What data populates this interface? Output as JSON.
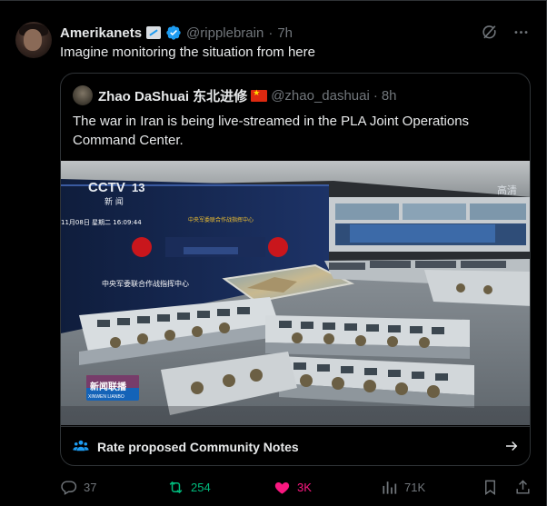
{
  "post": {
    "author_name": "Amerikanets",
    "handle": "@ripplebrain",
    "separator": "·",
    "time": "7h",
    "text": "Imagine monitoring the situation from here"
  },
  "quoted": {
    "author_name": "Zhao DaShuai 东北进修",
    "handle": "@zhao_dashuai",
    "separator": "·",
    "time": "8h",
    "text": "The war in Iran is being live-streamed in the PLA Joint Operations Command Center."
  },
  "media": {
    "channel_logo": "CCTV",
    "channel_number": "13",
    "channel_sub": "新 闻",
    "hd_mark": "高清",
    "datetime": "11月08日 星期二 16:09:44",
    "center_name": "中央军委联合作战指挥中心",
    "center_name_small": "中央军委联合作战指挥中心",
    "program_logo": "新闻联播",
    "program_sub": "XINWEN LIANBO"
  },
  "community_notes": {
    "label": "Rate proposed Community Notes"
  },
  "actions": {
    "replies": "37",
    "reposts": "254",
    "likes": "3K",
    "views": "71K"
  },
  "colors": {
    "background": "#000000",
    "text": "#e7e9ea",
    "muted": "#71767b",
    "border": "#2f3336",
    "verified": "#1d9bf0",
    "repost": "#00ba7c",
    "like": "#f91880"
  }
}
